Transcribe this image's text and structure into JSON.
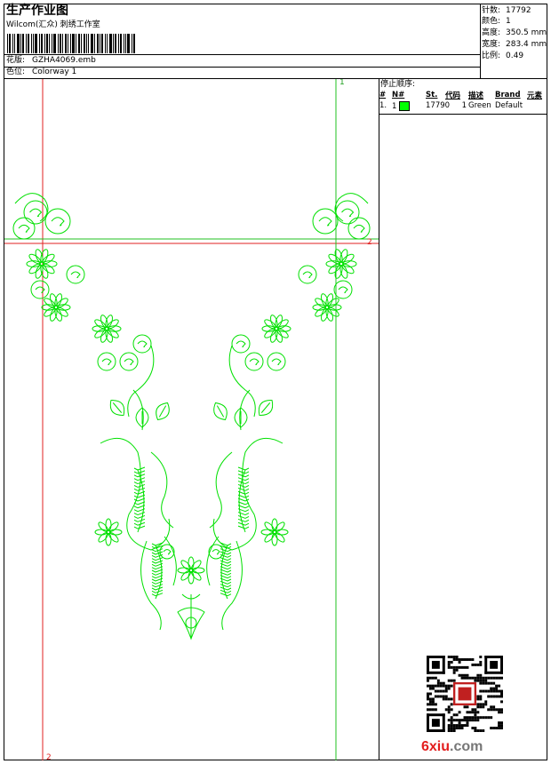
{
  "header": {
    "title": "生产作业图",
    "company": "Wilcom(汇众) 刺绣工作室",
    "design_label": "花版:",
    "design_value": "GZHA4069.emb",
    "color_label": "色位:",
    "color_value": "Colorway 1"
  },
  "specs": [
    {
      "label": "针数:",
      "value": "17792"
    },
    {
      "label": "颜色:",
      "value": "1"
    },
    {
      "label": "高度:",
      "value": "350.5 mm"
    },
    {
      "label": "宽度:",
      "value": "283.4 mm"
    },
    {
      "label": "比例:",
      "value": "0.49"
    }
  ],
  "stop_sequence": {
    "title": "停止顺序:",
    "columns": [
      "#",
      "N#",
      "St.",
      "代码",
      "描述",
      "Brand",
      "元素"
    ],
    "rows": [
      {
        "index": "1.",
        "needle": "1",
        "stitches": "17790",
        "code": "1",
        "description": "Green",
        "brand": "Default",
        "element": "",
        "color": "#00ff00"
      }
    ]
  },
  "guides": {
    "h_label": "2",
    "v_label_top": "1",
    "v_label_bottom": "2"
  },
  "colors": {
    "thread": "#00e000",
    "guide_red": "#e02020",
    "guide_green": "#20c020"
  },
  "watermark": {
    "brand": "6xiu",
    "domain": ".com"
  }
}
